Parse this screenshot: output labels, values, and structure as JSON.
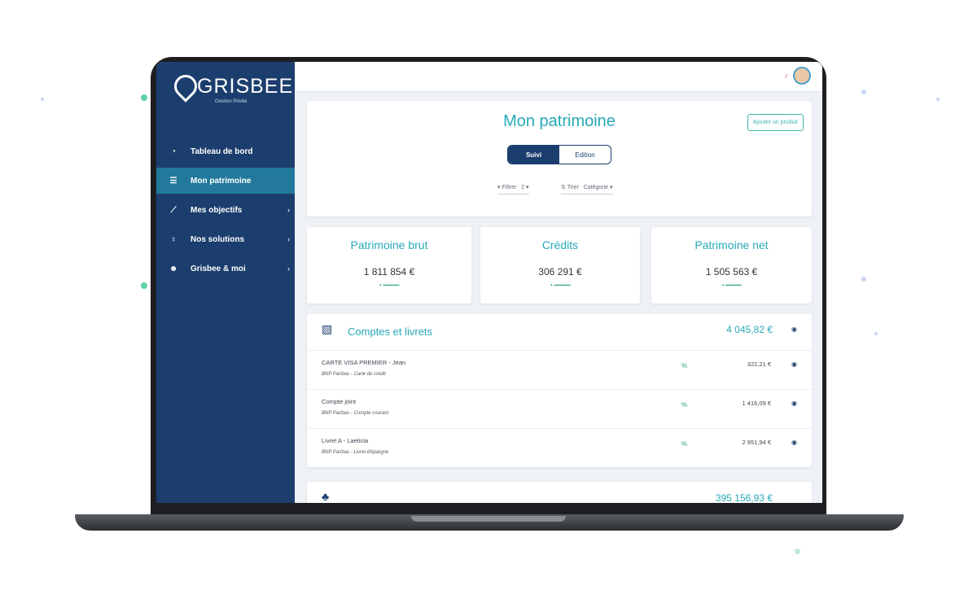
{
  "brand": {
    "name": "GRISBEE",
    "tagline": "Gestion Privée"
  },
  "sidebar": {
    "items": [
      {
        "label": "Tableau de bord",
        "icon": "dashboard-icon"
      },
      {
        "label": "Mon patrimoine",
        "icon": "list-icon",
        "active": true
      },
      {
        "label": "Mes objectifs",
        "icon": "chart-icon"
      },
      {
        "label": "Nos solutions",
        "icon": "bulb-icon"
      },
      {
        "label": "Grisbee & moi",
        "icon": "people-icon"
      }
    ]
  },
  "header": {
    "title": "Mon patrimoine",
    "add_label": "Ajouter un produit"
  },
  "toggle": {
    "on": "Suivi",
    "off": "Edition"
  },
  "filters": {
    "filter_label": "Filtrer",
    "filter_value": "2",
    "sort_label": "Trier",
    "sort_value": "Catégorie"
  },
  "kpis": [
    {
      "title": "Patrimoine brut",
      "value": "1 811 854 €"
    },
    {
      "title": "Crédits",
      "value": "306 291 €"
    },
    {
      "title": "Patrimoine net",
      "value": "1 505 563 €"
    }
  ],
  "section": {
    "title": "Comptes et livrets",
    "total": "4 045,82 €",
    "rows": [
      {
        "name": "CARTE VISA PREMIER - Jean",
        "sub": "BNP Paribas - Carte de crédit",
        "amount": "322,21 €"
      },
      {
        "name": "Compte joint",
        "sub": "BNP Paribas - Compte courant",
        "amount": "1 416,09 €"
      },
      {
        "name": "Livret A - Laeticia",
        "sub": "BNP Paribas - Livret d'épargne",
        "amount": "2 951,94 €"
      }
    ]
  },
  "next_section": {
    "total": "395 156,93 €"
  },
  "colors": {
    "sidebar": "#1c3e6e",
    "accent": "#27a9b7",
    "active": "#22799c",
    "positive": "#2aa77c"
  }
}
